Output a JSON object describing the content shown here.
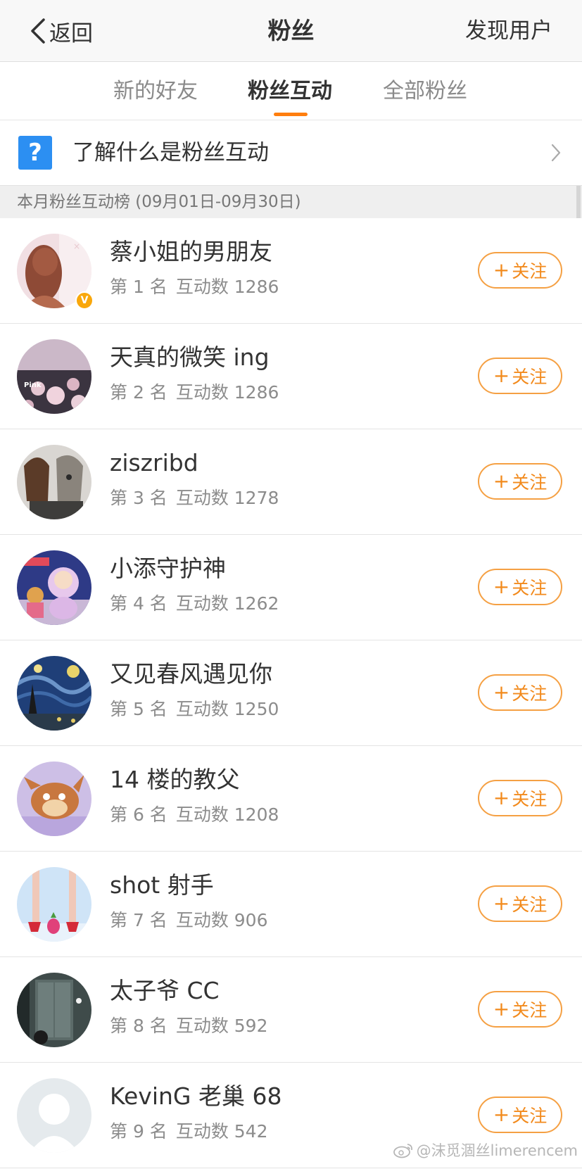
{
  "nav": {
    "back_label": "返回",
    "title": "粉丝",
    "right_action": "发现用户"
  },
  "tabs": [
    {
      "label": "新的好友",
      "active": false
    },
    {
      "label": "粉丝互动",
      "active": true
    },
    {
      "label": "全部粉丝",
      "active": false
    }
  ],
  "info": {
    "icon": "question-icon",
    "icon_char": "?",
    "text": "了解什么是粉丝互动"
  },
  "section": {
    "title": "本月粉丝互动榜 (09月01日-09月30日)"
  },
  "follow_label": "关注",
  "fans": [
    {
      "name": "蔡小姐的男朋友",
      "rank": "第 1 名",
      "interactions": "互动数 1286",
      "verified": true,
      "verified_char": "V"
    },
    {
      "name": "天真的微笑 ing",
      "rank": "第 2 名",
      "interactions": "互动数 1286",
      "avatar_text": "Pink"
    },
    {
      "name": "ziszribd",
      "rank": "第 3 名",
      "interactions": "互动数 1278"
    },
    {
      "name": "小添守护神",
      "rank": "第 4 名",
      "interactions": "互动数 1262"
    },
    {
      "name": "又见春风遇见你",
      "rank": "第 5 名",
      "interactions": "互动数 1250"
    },
    {
      "name": "14 楼的教父",
      "rank": "第 6 名",
      "interactions": "互动数 1208"
    },
    {
      "name": "shot 射手",
      "rank": "第 7 名",
      "interactions": "互动数 906"
    },
    {
      "name": "太子爷 CC",
      "rank": "第 8 名",
      "interactions": "互动数 592"
    },
    {
      "name": "KevinG 老巢 68",
      "rank": "第 9 名",
      "interactions": "互动数 542"
    }
  ],
  "watermark": {
    "text": "@沫觅涸丝limerencem",
    "icon": "weibo-logo-icon"
  },
  "colors": {
    "accent": "#ff7e0e",
    "follow": "#f28a1c",
    "help_icon": "#2c8ff2",
    "verified": "#f9a70b"
  }
}
